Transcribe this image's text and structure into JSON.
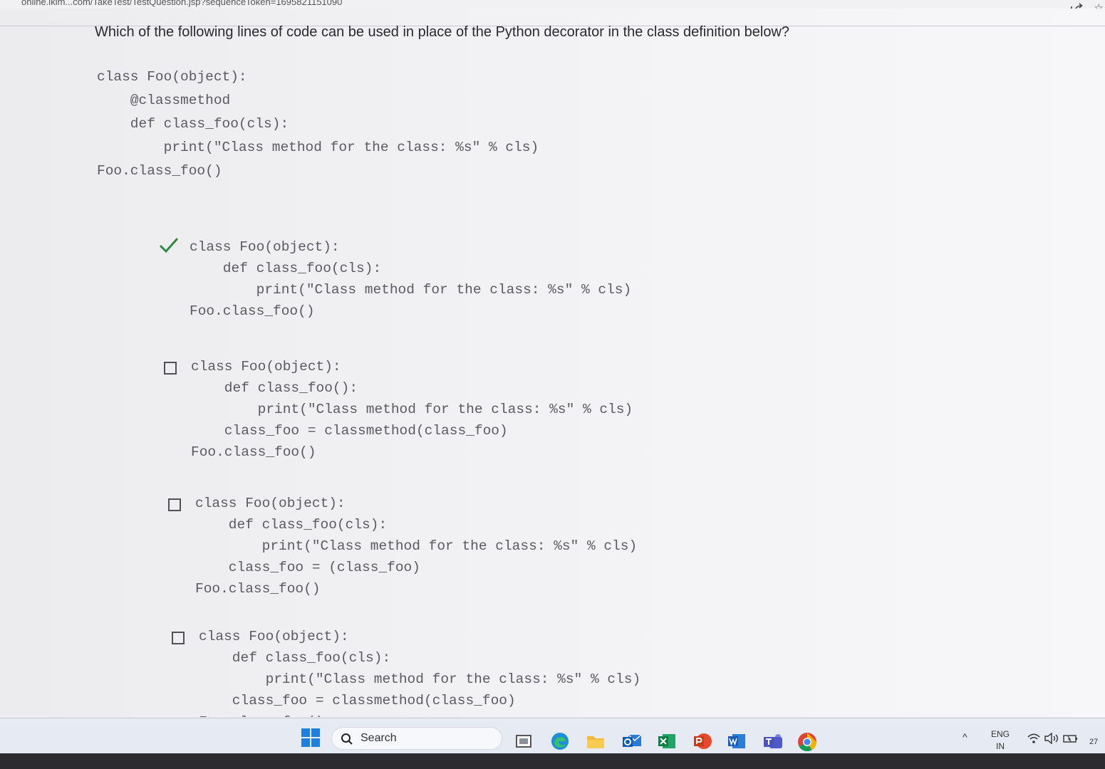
{
  "browser": {
    "url": "online.iklm...com/TakeTest/TestQuestion.jsp?sequenceToken=1695821151090"
  },
  "question": {
    "text": "Which of the following lines of code can be used in place of the Python decorator in the class definition below?",
    "code": [
      "class Foo(object):",
      "    @classmethod",
      "    def class_foo(cls):",
      "        print(\"Class method for the class: %s\" % cls)",
      "Foo.class_foo()"
    ]
  },
  "options": [
    {
      "selected": true,
      "code": [
        "class Foo(object):",
        "    def class_foo(cls):",
        "        print(\"Class method for the class: %s\" % cls)",
        "Foo.class_foo()"
      ]
    },
    {
      "selected": false,
      "code": [
        "class Foo(object):",
        "    def class_foo():",
        "        print(\"Class method for the class: %s\" % cls)",
        "    class_foo = classmethod(class_foo)",
        "Foo.class_foo()"
      ]
    },
    {
      "selected": false,
      "code": [
        "class Foo(object):",
        "    def class_foo(cls):",
        "        print(\"Class method for the class: %s\" % cls)",
        "    class_foo = (class_foo)",
        "Foo.class_foo()"
      ]
    },
    {
      "selected": false,
      "code": [
        "class Foo(object):",
        "    def class_foo(cls):",
        "        print(\"Class method for the class: %s\" % cls)",
        "    class_foo = classmethod(class_foo)",
        "Foo.class_foo()"
      ]
    }
  ],
  "taskbar": {
    "search_label": "Search",
    "apps": [
      "file-manager-icon",
      "edge-icon",
      "folder-icon",
      "outlook-icon",
      "excel-icon",
      "powerpoint-icon",
      "word-icon",
      "teams-icon",
      "chrome-icon"
    ],
    "lang_line1": "ENG",
    "lang_line2": "IN",
    "clock_fragment": "27"
  },
  "colors": {
    "tick": "#2f8a3e",
    "code_text": "#5a5a60",
    "question_text": "#2a2a2e",
    "taskbar_bg": "#e6eaf2"
  }
}
